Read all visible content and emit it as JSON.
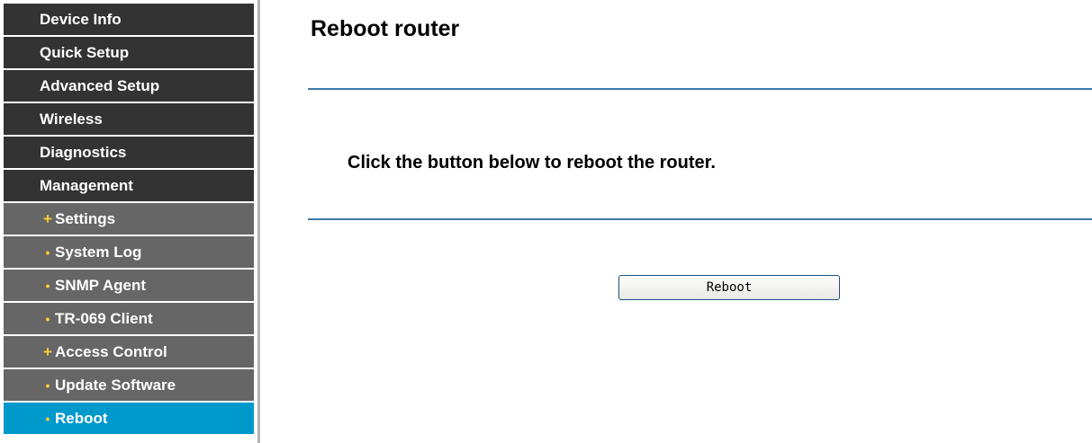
{
  "sidebar": {
    "items": [
      {
        "label": "Device Info",
        "level": "top",
        "active": false
      },
      {
        "label": "Quick Setup",
        "level": "top",
        "active": false
      },
      {
        "label": "Advanced Setup",
        "level": "top",
        "active": false
      },
      {
        "label": "Wireless",
        "level": "top",
        "active": false
      },
      {
        "label": "Diagnostics",
        "level": "top",
        "active": false
      },
      {
        "label": "Management",
        "level": "top",
        "active": false
      },
      {
        "label": "Settings",
        "level": "sub",
        "bullet": "+",
        "active": false
      },
      {
        "label": "System Log",
        "level": "sub",
        "bullet": "•",
        "active": false
      },
      {
        "label": "SNMP Agent",
        "level": "sub",
        "bullet": "•",
        "active": false
      },
      {
        "label": "TR-069 Client",
        "level": "sub",
        "bullet": "•",
        "active": false
      },
      {
        "label": "Access Control",
        "level": "sub",
        "bullet": "+",
        "active": false
      },
      {
        "label": "Update Software",
        "level": "sub",
        "bullet": "•",
        "active": false
      },
      {
        "label": "Reboot",
        "level": "sub",
        "bullet": "•",
        "active": true
      }
    ]
  },
  "main": {
    "title": "Reboot router",
    "instruction": "Click the button below to reboot the router.",
    "reboot_button_label": "Reboot"
  },
  "colors": {
    "menu_top_bg": "#333333",
    "menu_sub_bg": "#666666",
    "menu_active_bg": "#0099cc",
    "bullet": "#ffcc33",
    "rule": "#3d7aa8"
  }
}
